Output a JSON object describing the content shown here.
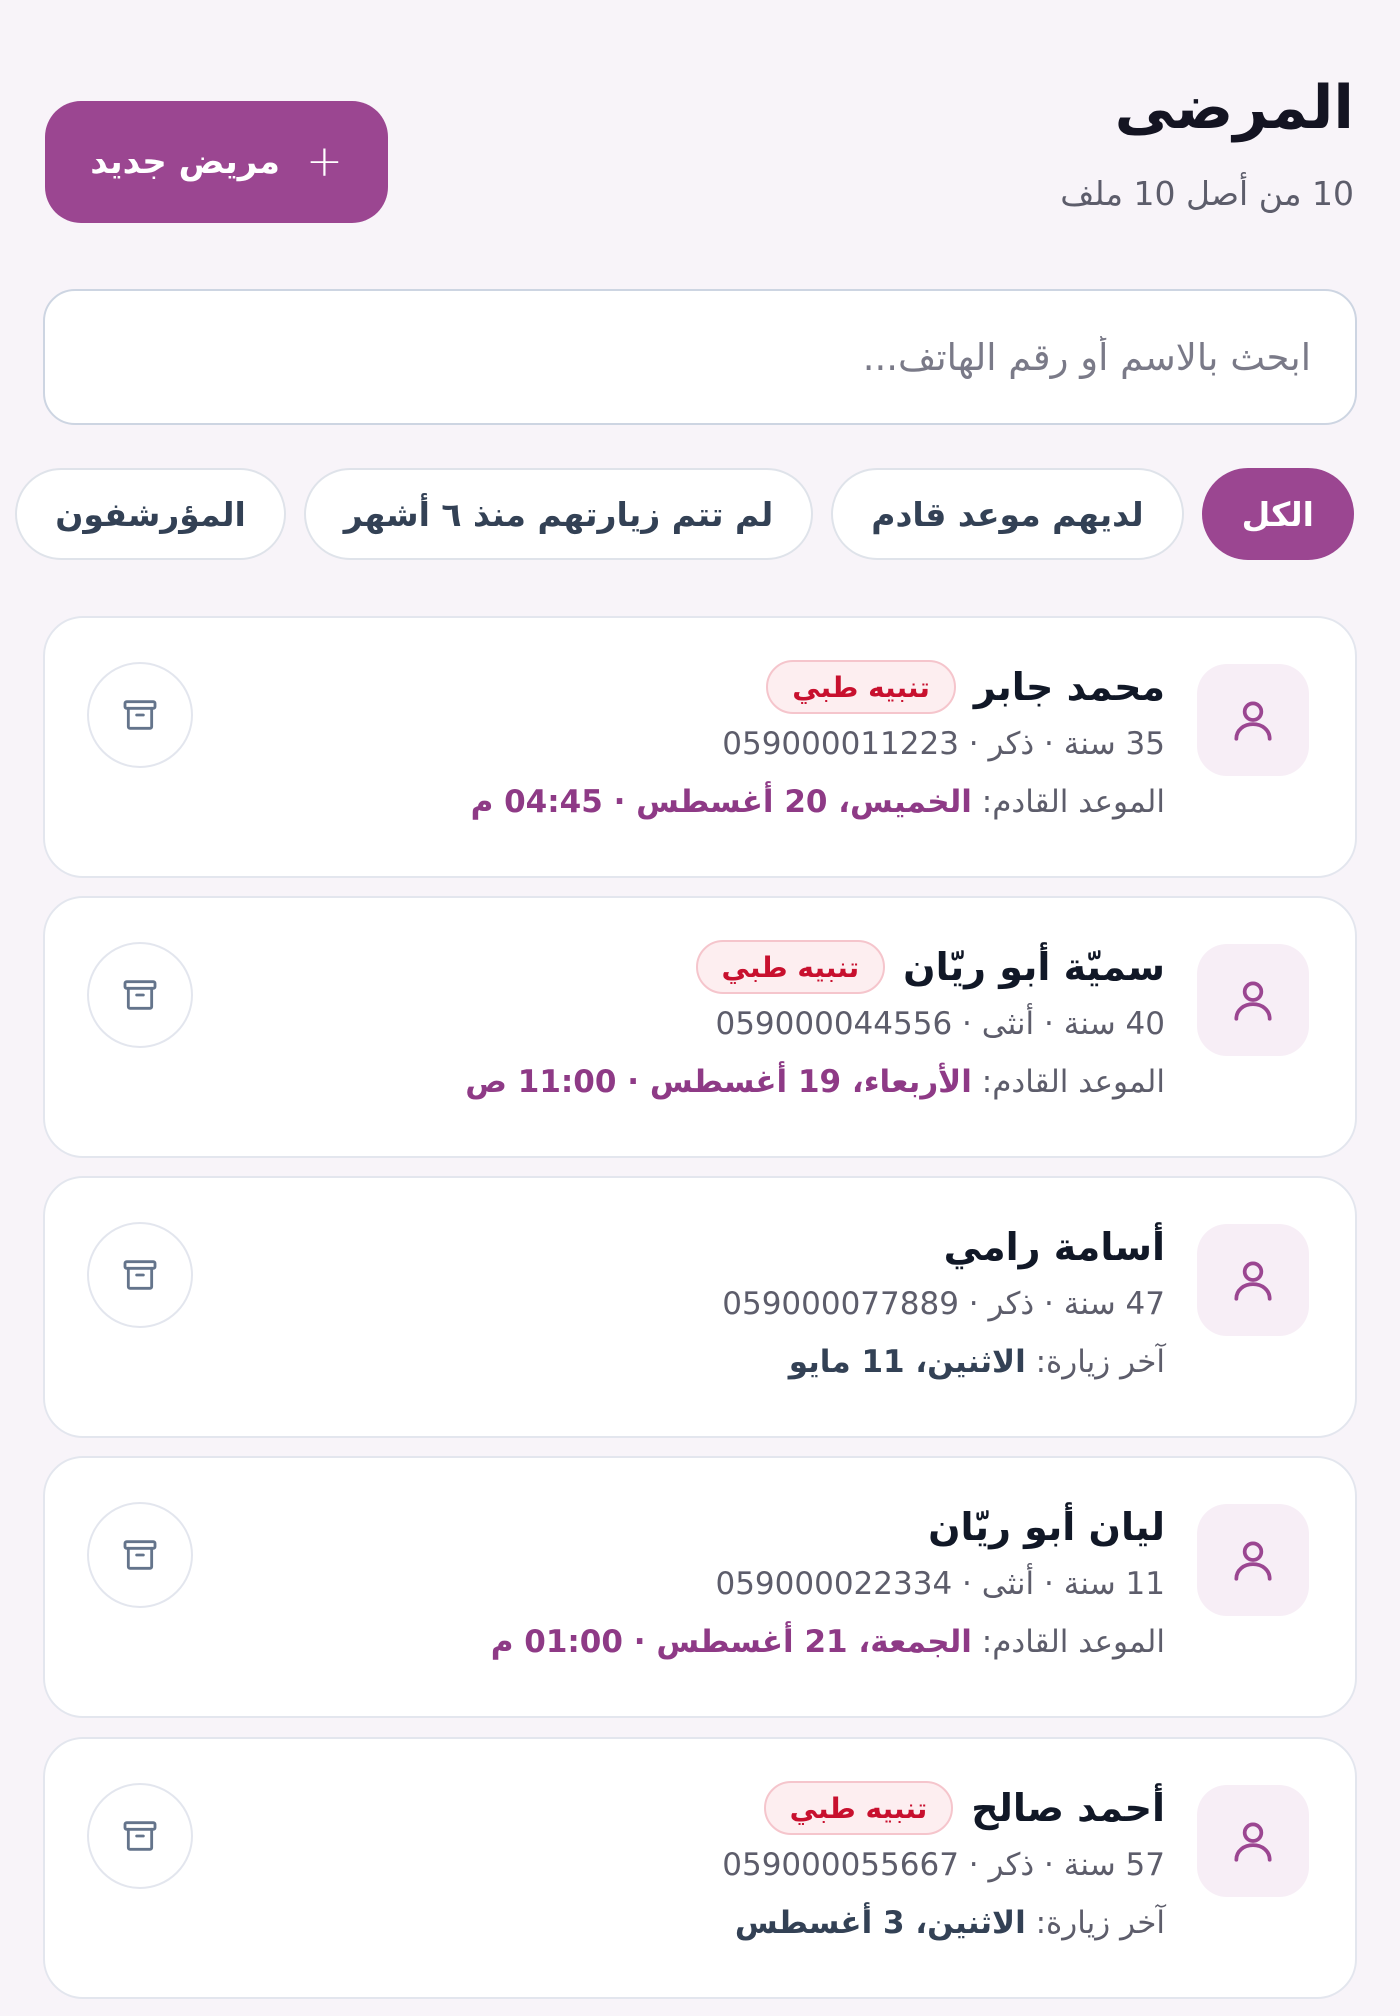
{
  "header": {
    "title": "المرضى",
    "subtitle": "10 من أصل 10 ملف",
    "new_patient_label": "مريض جديد"
  },
  "search": {
    "placeholder": "ابحث بالاسم أو رقم الهاتف..."
  },
  "filters": [
    {
      "label": "الكل",
      "active": true
    },
    {
      "label": "لديهم موعد قادم",
      "active": false
    },
    {
      "label": "لم تتم زيارتهم منذ ٦ أشهر",
      "active": false
    },
    {
      "label": "المؤرشفون",
      "active": false
    }
  ],
  "patients": [
    {
      "name": "محمد جابر",
      "badge": "تنبيه طبي",
      "meta": "35 سنة · ذكر · 059000011223",
      "appt_label": "الموعد القادم:",
      "appt_value": "الخميس، 20 أغسطس · 04:45 م",
      "appt_type": "upcoming"
    },
    {
      "name": "سميّة أبو ريّان",
      "badge": "تنبيه طبي",
      "meta": "40 سنة · أنثى · 059000044556",
      "appt_label": "الموعد القادم:",
      "appt_value": "الأربعاء، 19 أغسطس · 11:00 ص",
      "appt_type": "upcoming"
    },
    {
      "name": "أسامة رامي",
      "badge": "",
      "meta": "47 سنة · ذكر · 059000077889",
      "appt_label": "آخر زيارة:",
      "appt_value": "الاثنين، 11 مايو",
      "appt_type": "last"
    },
    {
      "name": "ليان أبو ريّان",
      "badge": "",
      "meta": "11 سنة · أنثى · 059000022334",
      "appt_label": "الموعد القادم:",
      "appt_value": "الجمعة، 21 أغسطس · 01:00 م",
      "appt_type": "upcoming"
    },
    {
      "name": "أحمد صالح",
      "badge": "تنبيه طبي",
      "meta": "57 سنة · ذكر · 059000055667",
      "appt_label": "آخر زيارة:",
      "appt_value": "الاثنين، 3 أغسطس",
      "appt_type": "last"
    }
  ],
  "colors": {
    "accent": "#9b4691",
    "alert": "#c8102e",
    "background": "#f8f4f9"
  },
  "icons": {
    "new_patient": "plus-icon",
    "avatar": "user-icon",
    "archive": "archive-icon"
  }
}
